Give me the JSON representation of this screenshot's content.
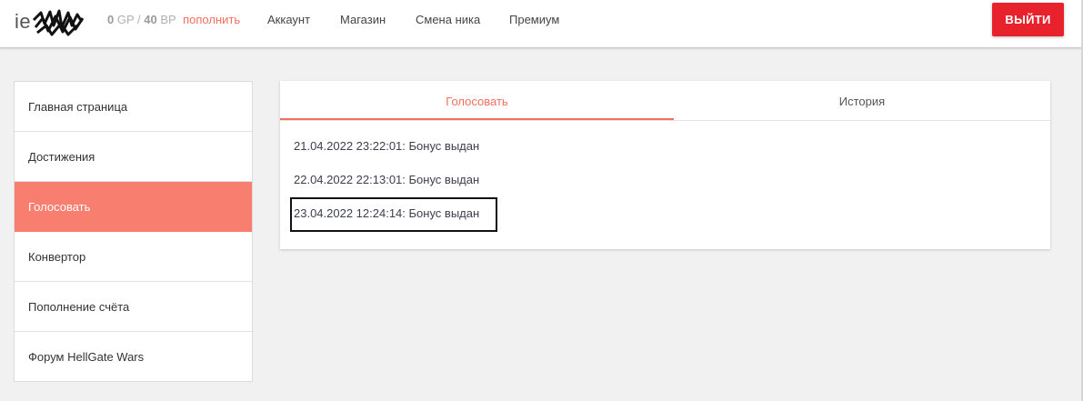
{
  "header": {
    "username_visible": "ie",
    "balance": {
      "gp_value": "0",
      "gp_unit": "GP",
      "separator": "/",
      "bp_value": "40",
      "bp_unit": "BP",
      "topup_label": "пополнить"
    },
    "nav": [
      "Аккаунт",
      "Магазин",
      "Смена ника",
      "Премиум"
    ],
    "logout_label": "ВЫЙТИ",
    "colors": {
      "accent": "#f0705f",
      "logout": "#e8222c"
    }
  },
  "sidebar": {
    "items": [
      {
        "label": "Главная страница"
      },
      {
        "label": "Достижения"
      },
      {
        "label": "Голосовать",
        "active": true
      },
      {
        "label": "Конвертор"
      },
      {
        "label": "Пополнение счёта"
      },
      {
        "label": "Форум HellGate Wars"
      }
    ]
  },
  "card": {
    "tabs": [
      {
        "label": "Голосовать",
        "active": true
      },
      {
        "label": "История"
      }
    ],
    "entries": [
      "21.04.2022 23:22:01: Бонус выдан",
      "22.04.2022 22:13:01: Бонус выдан",
      "23.04.2022 12:24:14: Бонус выдан"
    ]
  }
}
